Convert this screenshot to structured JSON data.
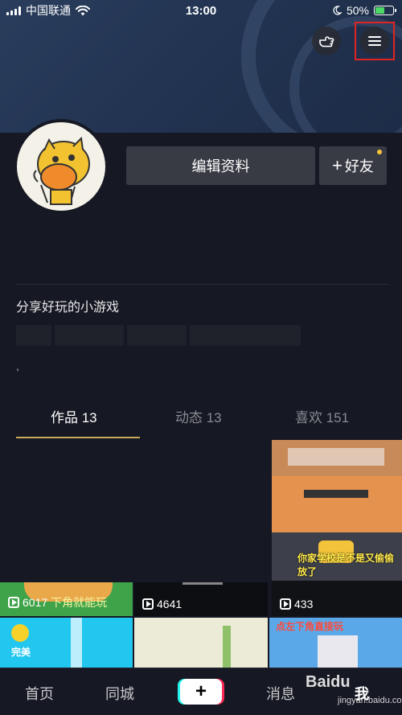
{
  "status_bar": {
    "carrier": "中国联通",
    "time": "13:00",
    "battery": "50%",
    "battery_level": 0.5
  },
  "header": {
    "gesture_button": "hand-point-icon",
    "menu_button": "menu-icon"
  },
  "profile": {
    "edit_label": "编辑资料",
    "add_friend_label": "好友",
    "add_friend_prefix": "+",
    "bio": "分享好玩的小游戏",
    "bio_extra": ","
  },
  "tabs": [
    {
      "label": "作品 13",
      "active": true
    },
    {
      "label": "动态 13",
      "active": false
    },
    {
      "label": "喜欢 151",
      "active": false
    }
  ],
  "videos": [
    {
      "play_count": "6017",
      "caption": "下角就能玩"
    },
    {
      "play_count": "4641",
      "caption": ""
    },
    {
      "play_count": "433",
      "caption": "你家学校是不是又偷偷放了"
    }
  ],
  "bottom_row": [
    {
      "caption": "完美"
    },
    {
      "caption": ""
    },
    {
      "caption": "点左下角直接玩"
    }
  ],
  "nav": {
    "home": "首页",
    "city": "同城",
    "create": "+",
    "messages": "消息",
    "me": "我"
  },
  "watermark": {
    "brand": "Baidu",
    "sub": "jingyan.baidu.com"
  },
  "colors": {
    "background": "#161823",
    "button": "#393b44",
    "tab_underline": "#c8a95a",
    "highlight_box": "#e02424",
    "notification_dot": "#f5c53d"
  }
}
